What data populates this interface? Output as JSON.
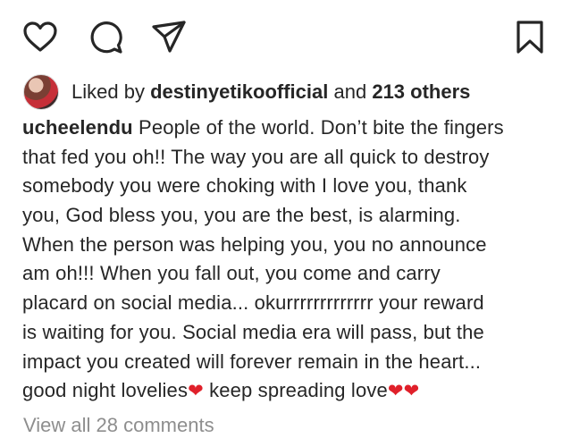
{
  "actions": {
    "like_icon": "heart-outline",
    "comment_icon": "speech-bubble-outline",
    "share_icon": "paper-plane-outline",
    "save_icon": "bookmark-outline",
    "icon_color": "#262626"
  },
  "likes": {
    "prefix": "Liked by",
    "user": "destinyetikoofficial",
    "connector": "and",
    "others": "213 others"
  },
  "caption": {
    "username": "ucheelendu",
    "lines": [
      " People of the world. Don’t bite the fingers",
      "that fed you oh!! The way you are all quick to destroy",
      "somebody you were choking with I love you, thank",
      "you, God bless you, you are the best, is alarming.",
      "When the person was helping you, you no announce",
      "am oh!!! When you fall out, you come and carry",
      "placard on social media... okurrrrrrrrrrrrr your reward",
      "is waiting for you. Social media era will pass, but the",
      "impact you created will forever remain in the heart...",
      "good night lovelies"
    ],
    "last_line_middle": " keep spreading love",
    "heart_emoji": "❤",
    "heart_color": "#e0202a"
  },
  "comments": {
    "view_all_label": "View all 28 comments"
  }
}
